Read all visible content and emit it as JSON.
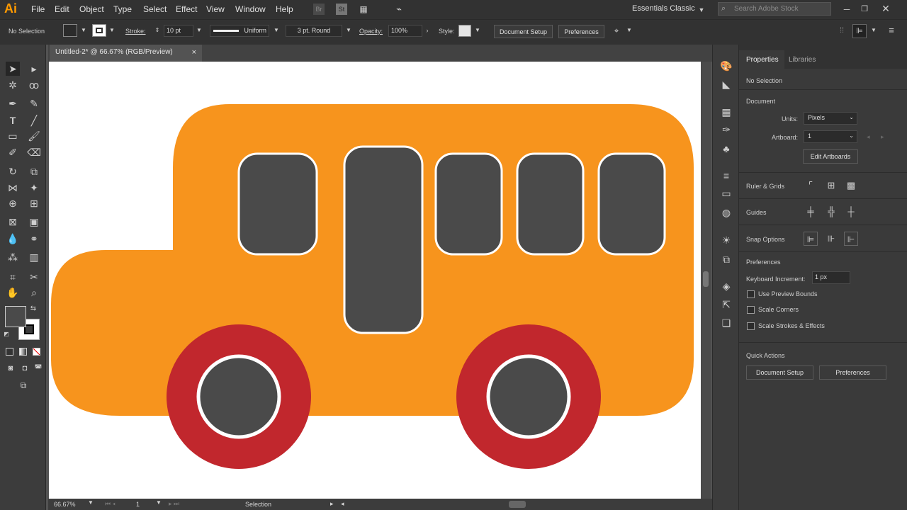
{
  "app": {
    "logo": "Ai",
    "workspace": "Essentials Classic",
    "search_placeholder": "Search Adobe Stock"
  },
  "menu": [
    "File",
    "Edit",
    "Object",
    "Type",
    "Select",
    "Effect",
    "View",
    "Window",
    "Help"
  ],
  "menu_icons": {
    "br": "Br",
    "st": "St"
  },
  "control": {
    "selection": "No Selection",
    "stroke_label": "Stroke:",
    "stroke_value": "10 pt",
    "profile": "Uniform",
    "brush": "3 pt. Round",
    "opacity_label": "Opacity:",
    "opacity_value": "100%",
    "style_label": "Style:",
    "document_setup": "Document Setup",
    "preferences": "Preferences"
  },
  "document": {
    "tab_title": "Untitled-2* @ 66.67% (RGB/Preview)",
    "close": "×"
  },
  "status": {
    "zoom": "66.67%",
    "artboard": "1",
    "tool": "Selection"
  },
  "panel": {
    "tabs": [
      "Properties",
      "Libraries"
    ],
    "selection": "No Selection",
    "document_heading": "Document",
    "units_label": "Units:",
    "units_value": "Pixels",
    "artboard_label": "Artboard:",
    "artboard_value": "1",
    "edit_artboards": "Edit Artboards",
    "rulers": "Ruler & Grids",
    "guides": "Guides",
    "snap": "Snap Options",
    "preferences_heading": "Preferences",
    "keyboard_label": "Keyboard Increment:",
    "keyboard_value": "1 px",
    "checkboxes": [
      "Use Preview Bounds",
      "Scale Corners",
      "Scale Strokes & Effects"
    ],
    "quick_actions": "Quick Actions",
    "document_setup": "Document Setup",
    "preferences": "Preferences"
  },
  "colors": {
    "bus_body": "#f7941d",
    "window": "#4a4a4a",
    "wheel": "#c1272d",
    "stroke": "#ffffff"
  }
}
